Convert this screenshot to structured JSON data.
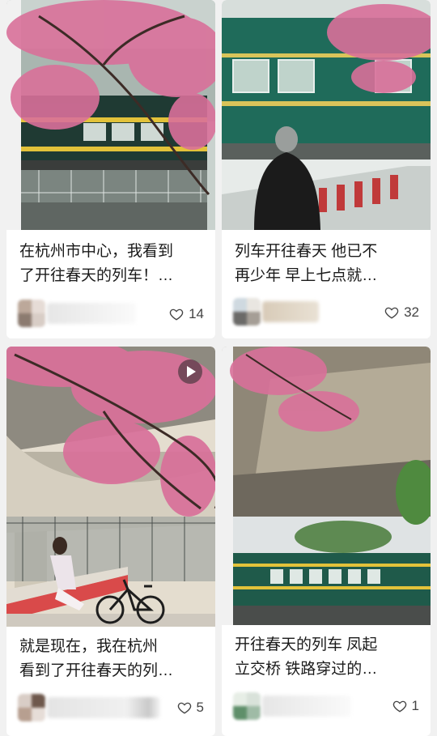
{
  "feed": {
    "cards": [
      {
        "title_line1": "在杭州市中心，我看到",
        "title_line2": "了开往春天的列车！…",
        "likes": "14",
        "image": "cherry-blossom-green-train",
        "has_video": false
      },
      {
        "title_line1": "列车开往春天 他已不",
        "title_line2": "再少年 早上七点就…",
        "likes": "32",
        "image": "man-watching-green-train",
        "has_video": false
      },
      {
        "title_line1": "就是现在，我在杭州",
        "title_line2": "看到了开往春天的列…",
        "likes": "5",
        "image": "woman-sitting-under-blossom-bridge",
        "has_video": true
      },
      {
        "title_line1": "开往春天的列车 凤起",
        "title_line2": "立交桥 铁路穿过的…",
        "likes": "1",
        "image": "overpass-blossom-green-train",
        "has_video": false
      }
    ]
  },
  "colors": {
    "blossom": "#d9709a",
    "train_green": "#1f5a4a",
    "train_stripe": "#e2c23a",
    "page_bg": "#f1f1f1"
  },
  "icons": {
    "like": "heart-outline-icon",
    "video": "play-icon"
  }
}
